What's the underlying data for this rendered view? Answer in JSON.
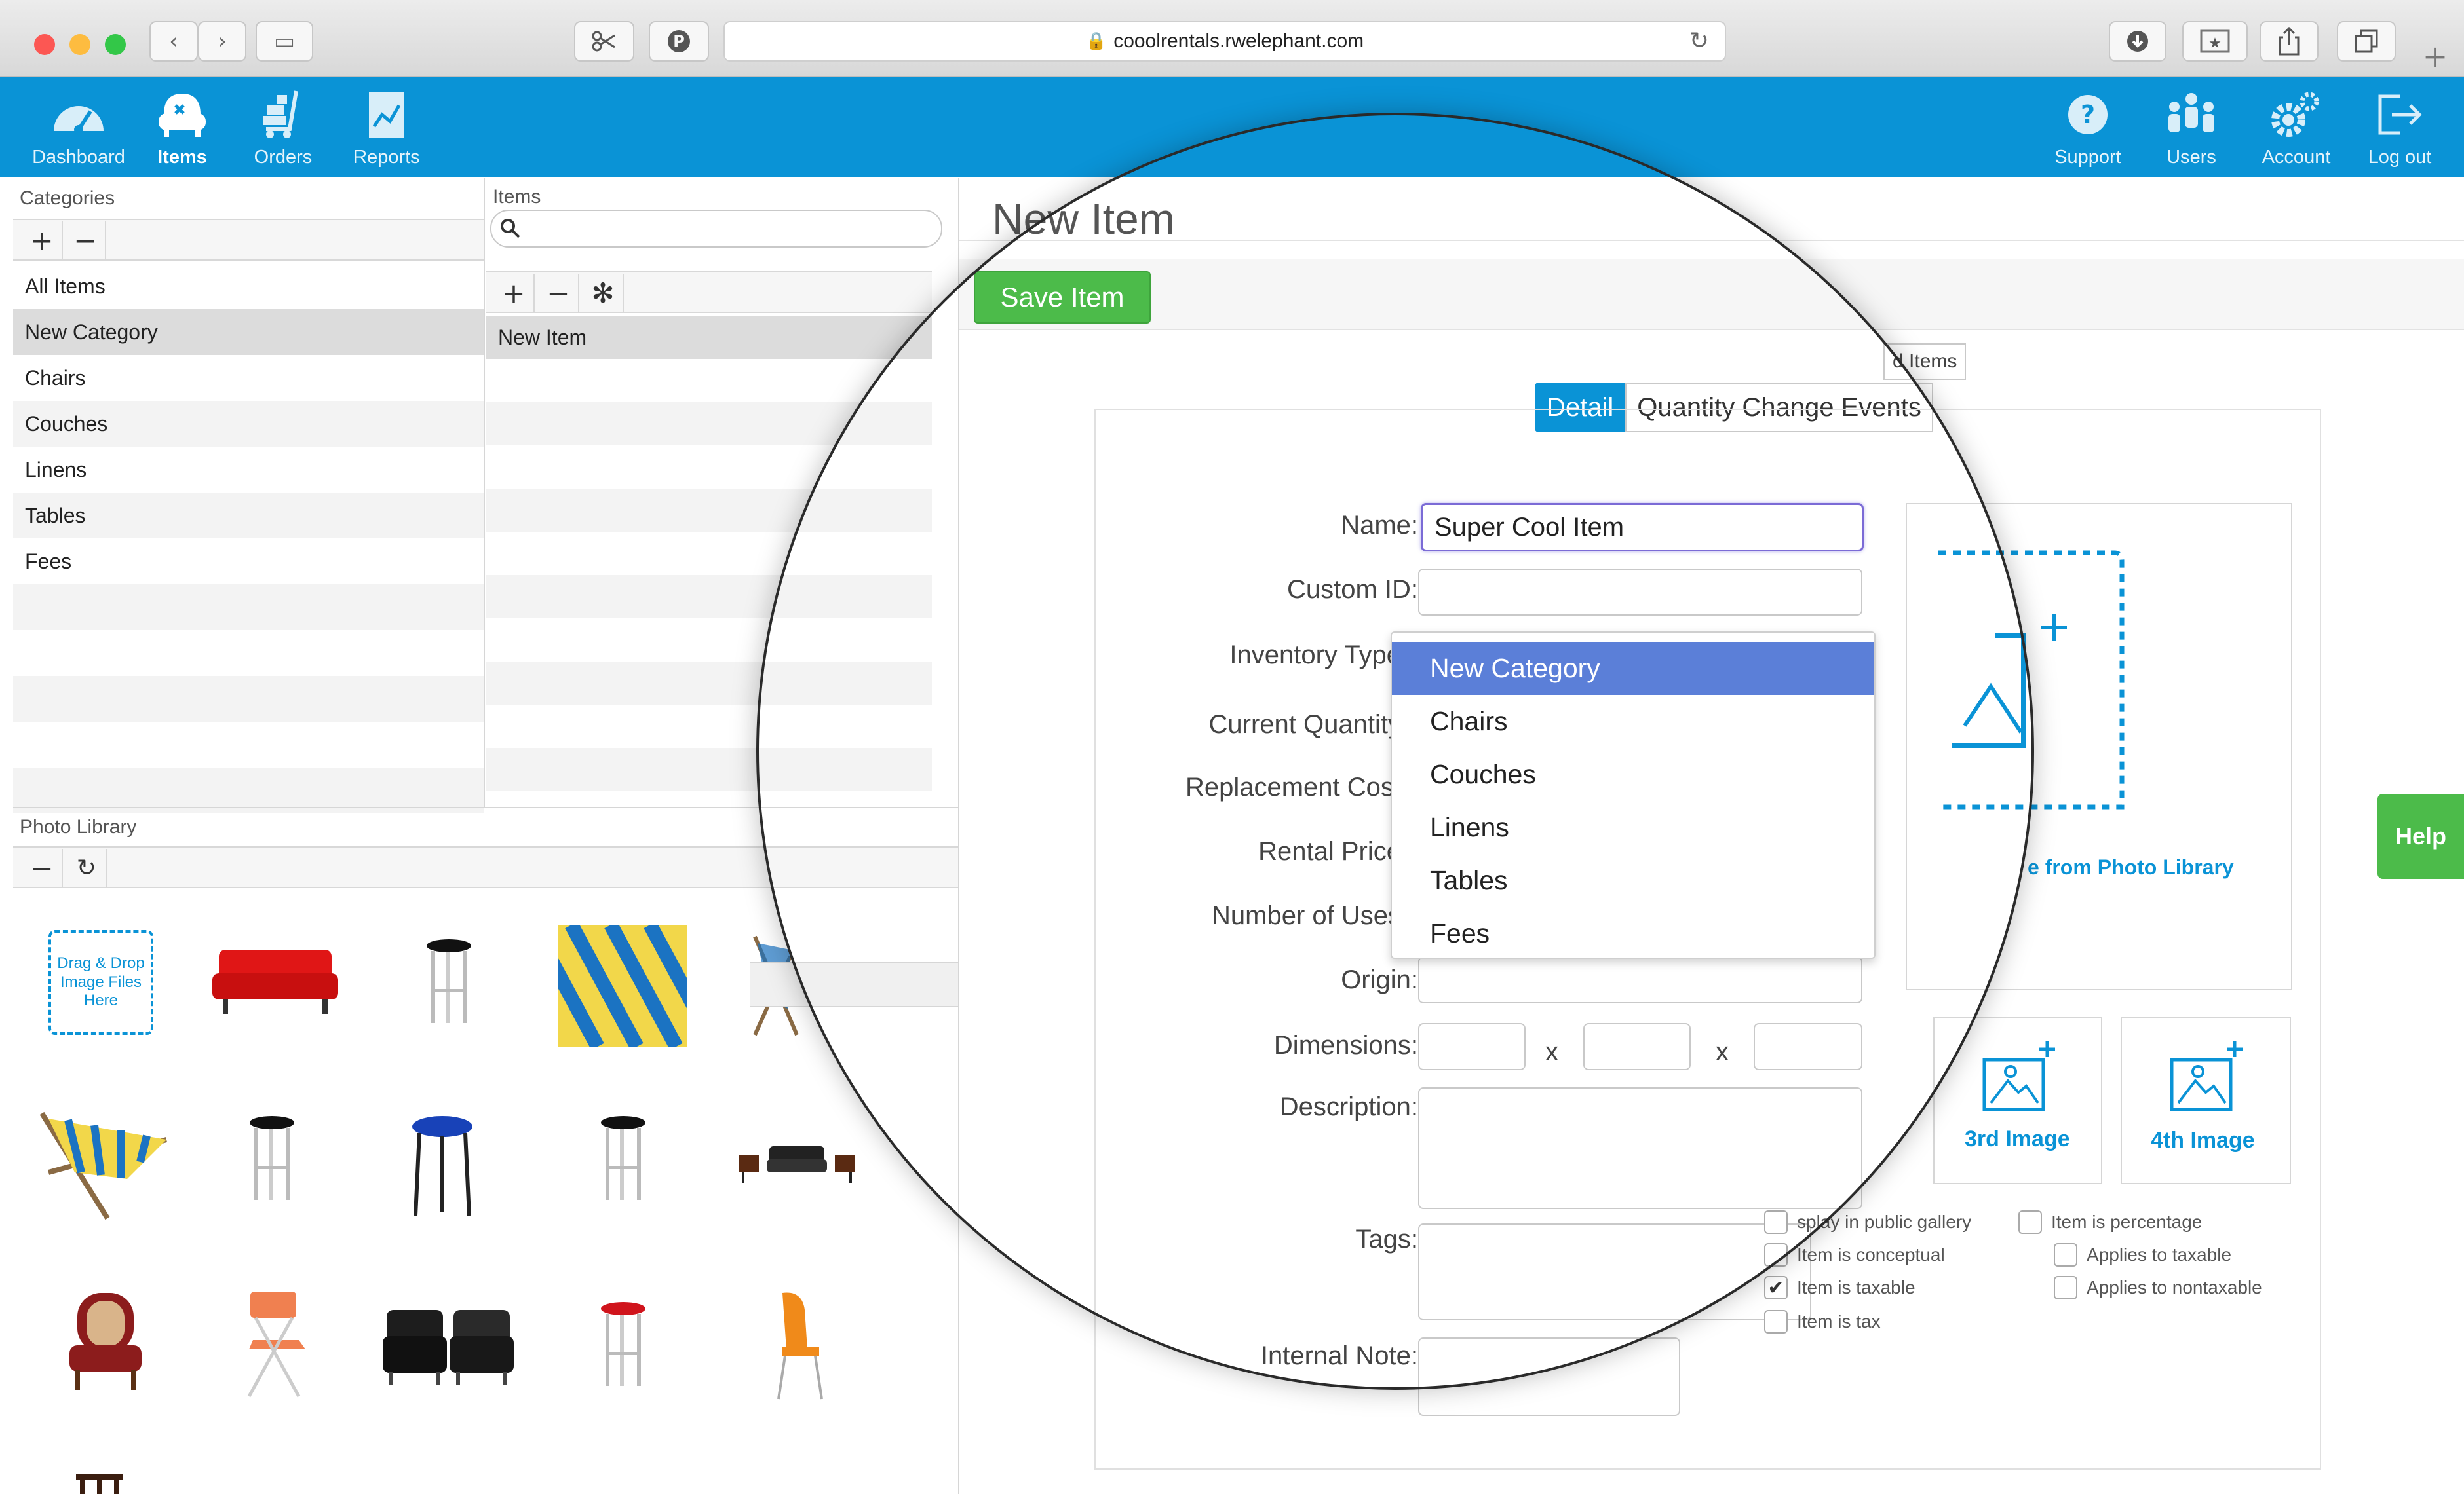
{
  "browser": {
    "url": "cooolrentals.rwelephant.com",
    "buttons": {
      "back": "‹",
      "forward": "›",
      "sidebar": "▭",
      "reload": "↻"
    }
  },
  "nav": {
    "left": [
      {
        "label": "Dashboard",
        "icon": "dashboard-icon"
      },
      {
        "label": "Items",
        "icon": "items-icon"
      },
      {
        "label": "Orders",
        "icon": "orders-icon"
      },
      {
        "label": "Reports",
        "icon": "reports-icon"
      }
    ],
    "right": [
      {
        "label": "Support",
        "icon": "support-icon"
      },
      {
        "label": "Users",
        "icon": "users-icon"
      },
      {
        "label": "Account",
        "icon": "account-icon"
      },
      {
        "label": "Log out",
        "icon": "logout-icon"
      }
    ],
    "accent": "#0a93d6"
  },
  "categories": {
    "header": "Categories",
    "items": [
      "All Items",
      "New Category",
      "Chairs",
      "Couches",
      "Linens",
      "Tables",
      "Fees"
    ],
    "selected": "New Category"
  },
  "items_pane": {
    "header": "Items",
    "search_placeholder": "",
    "items": [
      "New Item"
    ]
  },
  "photo_library": {
    "header": "Photo Library",
    "dropzone_text": "Drag & Drop Image Files Here"
  },
  "editor": {
    "title": "New Item",
    "save_label": "Save Item",
    "tabs": [
      "Detail",
      "Quantity Change Events"
    ],
    "related_tab": "d Items",
    "labels": {
      "name": "Name:",
      "custom_id": "Custom ID:",
      "inventory_type": "Inventory Type",
      "current_quantity": "Current Quantity",
      "replacement_cost": "Replacement Cost",
      "rental_price": "Rental Price",
      "number_of_uses": "Number of Uses",
      "origin": "Origin:",
      "dimensions": "Dimensions:",
      "description": "Description:",
      "tags": "Tags:",
      "internal_note": "Internal Note:"
    },
    "values": {
      "name": "Super Cool Item"
    },
    "dim_separator": "x",
    "dropdown": {
      "options": [
        "New Category",
        "Chairs",
        "Couches",
        "Linens",
        "Tables",
        "Fees"
      ],
      "selected": "New Category"
    },
    "images": {
      "library_link": "e from Photo Library",
      "third": "3rd Image",
      "fourth": "4th Image"
    },
    "checkboxes": [
      {
        "label": "splay in public gallery",
        "checked": false
      },
      {
        "label": "Item is conceptual",
        "checked": false
      },
      {
        "label": "Item is taxable",
        "checked": true
      },
      {
        "label": "Item is tax",
        "checked": false
      },
      {
        "label": "Item is percentage",
        "checked": false
      },
      {
        "label": "Applies to taxable",
        "checked": false
      },
      {
        "label": "Applies to nontaxable",
        "checked": false
      }
    ]
  },
  "help_label": "Help"
}
